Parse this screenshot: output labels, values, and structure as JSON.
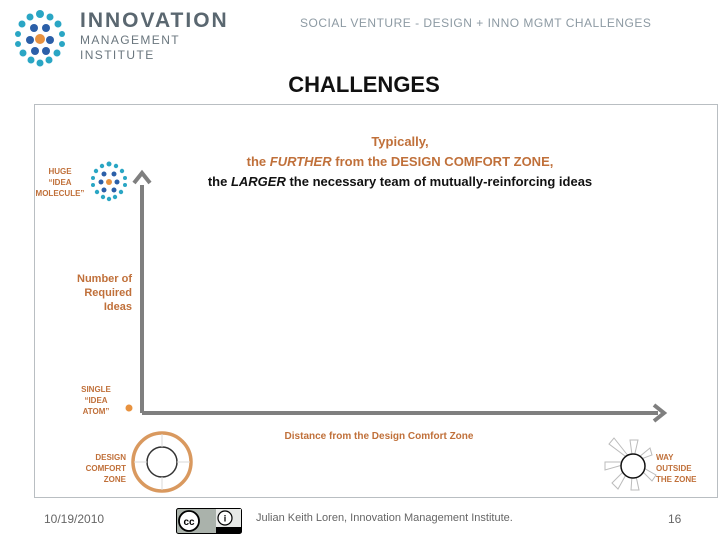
{
  "header": {
    "logo_line1": "INNOVATION",
    "logo_line2": "MANAGEMENT",
    "logo_line3": "INSTITUTE",
    "deck_title": "SOCIAL VENTURE - DESIGN + INNO MGMT CHALLENGES"
  },
  "slide": {
    "title": "CHALLENGES",
    "statement": {
      "line1": "Typically,",
      "line2_pre": "the ",
      "line2_em": "FURTHER",
      "line2_post": " from the DESIGN COMFORT ZONE,",
      "line3_pre": "the ",
      "line3_em": "LARGER",
      "line3_post": " the necessary team of mutually-reinforcing ideas"
    },
    "diagram": {
      "top_label": [
        "HUGE",
        "“IDEA",
        "MOLECULE”"
      ],
      "y_axis_label": [
        "Number of",
        "Required",
        "Ideas"
      ],
      "bottom_label": [
        "SINGLE",
        "“IDEA",
        "ATOM”"
      ],
      "x_axis_label": "Distance from the Design Comfort Zone",
      "origin_label": [
        "DESIGN",
        "COMFORT",
        "ZONE"
      ],
      "far_label": [
        "WAY",
        "OUTSIDE",
        "THE ZONE"
      ]
    }
  },
  "footer": {
    "date": "10/19/2010",
    "credit": "Julian Keith Loren, Innovation Management Institute.",
    "page": "16",
    "cc_text": "cc",
    "info_text": "i"
  },
  "colors": {
    "accent_orange": "#c0703a",
    "axis_gray": "#7f7f7f",
    "logo_teal": "#2aa6c4",
    "logo_blue": "#2b5fa8"
  }
}
